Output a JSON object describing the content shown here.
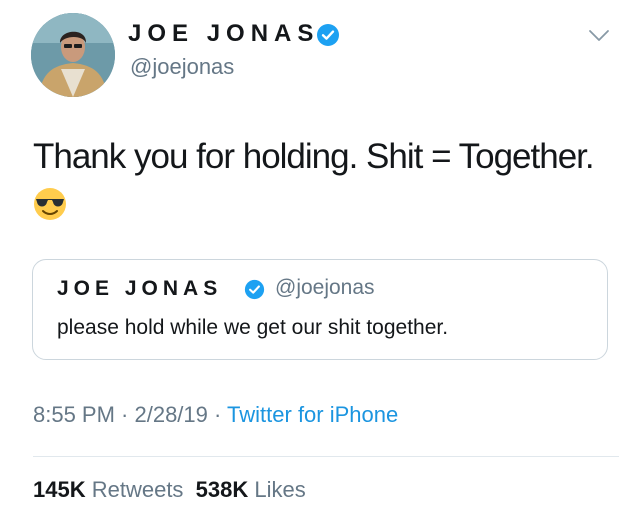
{
  "tweet": {
    "display_name": "JOE JONAS",
    "handle": "@joejonas",
    "verified_icon": "verified-badge-icon",
    "text": "Thank you for holding. Shit = Together.",
    "emoji": "😎",
    "timestamp": "8:55 PM · 2/28/19 · ",
    "source": "Twitter for iPhone"
  },
  "quoted_tweet": {
    "display_name": "JOE JONAS",
    "handle": "@joejonas",
    "text": "please hold while we get our shit together."
  },
  "stats": {
    "retweets_count": "145K",
    "retweets_label": "Retweets",
    "likes_count": "538K",
    "likes_label": "Likes"
  },
  "colors": {
    "verified": "#1da1f2",
    "link": "#1b95e0",
    "secondary_text": "#657786",
    "border": "#ccd6dd"
  }
}
